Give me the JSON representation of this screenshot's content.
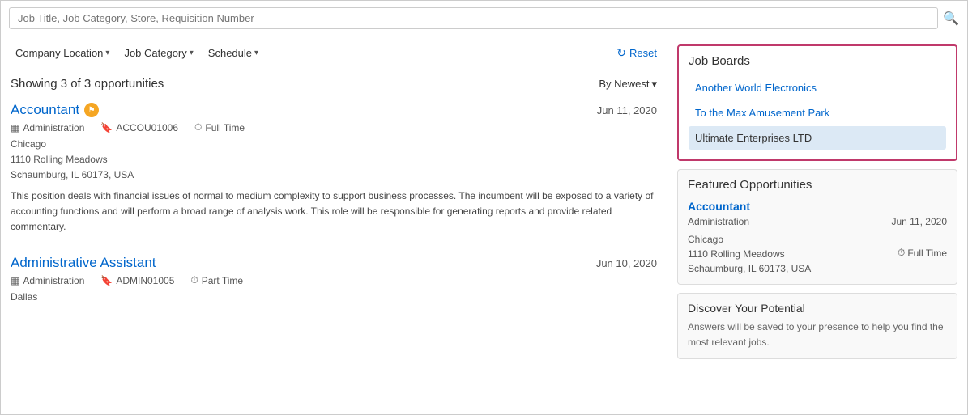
{
  "search": {
    "placeholder": "Job Title, Job Category, Store, Requisition Number"
  },
  "filters": {
    "company_location": "Company Location",
    "job_category": "Job Category",
    "schedule": "Schedule",
    "reset": "Reset"
  },
  "results": {
    "summary": "Showing 3 of 3 opportunities",
    "sort_label": "By Newest"
  },
  "jobs": [
    {
      "title": "Accountant",
      "has_badge": true,
      "date": "Jun 11, 2020",
      "department": "Administration",
      "req_number": "ACCOU01006",
      "schedule": "Full Time",
      "location_line1": "Chicago",
      "location_line2": "1110 Rolling Meadows",
      "location_line3": "Schaumburg, IL 60173, USA",
      "description": "This position deals with financial issues of normal to medium complexity to support business processes. The incumbent will be exposed to a variety of accounting functions and will perform a broad range of analysis work. This role will be responsible for generating reports and provide related commentary."
    },
    {
      "title": "Administrative Assistant",
      "has_badge": false,
      "date": "Jun 10, 2020",
      "department": "Administration",
      "req_number": "ADMIN01005",
      "schedule": "Part Time",
      "location_line1": "Dallas",
      "location_line2": "",
      "location_line3": "",
      "description": ""
    }
  ],
  "job_boards": {
    "title": "Job Boards",
    "items": [
      {
        "label": "Another World Electronics",
        "selected": false
      },
      {
        "label": "To the Max Amusement Park",
        "selected": false
      },
      {
        "label": "Ultimate Enterprises LTD",
        "selected": true
      }
    ]
  },
  "featured": {
    "title": "Featured Opportunities",
    "job": {
      "title": "Accountant",
      "department": "Administration",
      "date": "Jun 11, 2020",
      "schedule": "Full Time",
      "location_line1": "Chicago",
      "location_line2": "1110 Rolling Meadows",
      "location_line3": "Schaumburg, IL 60173, USA"
    }
  },
  "discover": {
    "title": "Discover Your Potential",
    "text": "Answers will be saved to your presence to help you find the most relevant jobs."
  },
  "icons": {
    "search": "🔍",
    "chevron_down": "▾",
    "reset": "↻",
    "department": "▦",
    "bookmark": "🔖",
    "clock": "⏱",
    "flag": "⚑"
  }
}
